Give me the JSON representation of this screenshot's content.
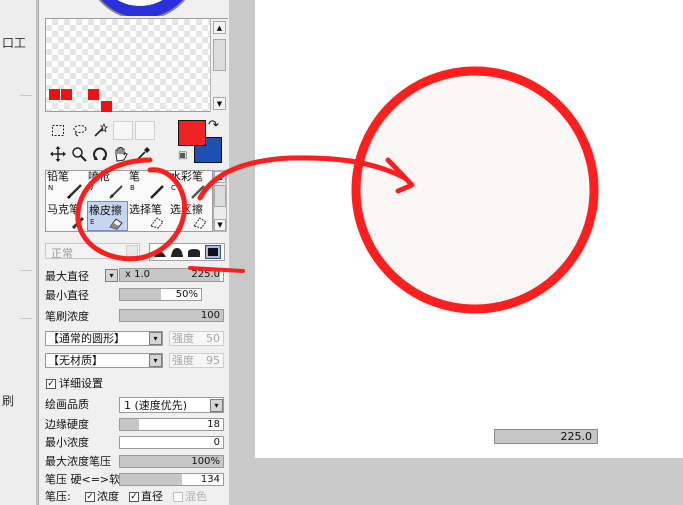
{
  "left_strip": {
    "glyph_top": "口工",
    "glyph_bottom": "刷"
  },
  "texture_grid": {
    "scroll_up": "▲",
    "scroll_down": "▼"
  },
  "selection_tools": {
    "tool_icons": [
      "rect-select-icon",
      "lasso-icon",
      "magic-wand-icon",
      "move-icon",
      "zoom-icon",
      "rotate-icon",
      "hand-icon",
      "eyedropper-icon"
    ]
  },
  "colors": {
    "primary": "#ee2222",
    "secondary": "#1e4fb4",
    "swap_glyph": "↷",
    "reset_glyph": "▣"
  },
  "tools": [
    {
      "name": "铅笔",
      "key": "N"
    },
    {
      "name": "喷枪",
      "key": "V"
    },
    {
      "name": "笔",
      "key": "B"
    },
    {
      "name": "水彩笔",
      "key": "C"
    },
    {
      "name": "马克笔",
      "key": ""
    },
    {
      "name": "橡皮擦",
      "key": "E"
    },
    {
      "name": "选择笔",
      "key": ""
    },
    {
      "name": "选区擦",
      "key": ""
    }
  ],
  "tool_scroll": {
    "up": "▲",
    "down": "▼"
  },
  "blend_mode": {
    "value": "正常"
  },
  "brush_shapes": [
    "soft-round-icon",
    "medium-round-icon",
    "hard-round-icon",
    "square-brush-icon"
  ],
  "max_diameter": {
    "label": "最大直径",
    "multiplier": "x 1.0",
    "value": "225.0",
    "fraction": 0.97
  },
  "min_diameter": {
    "label": "最小直径",
    "value": "50%",
    "fraction": 0.5
  },
  "brush_density": {
    "label": "笔刷浓度",
    "value": "100",
    "fraction": 1.0
  },
  "shape_select": {
    "value": "【通常的圆形】",
    "strength_label": "强度",
    "strength_value": "50"
  },
  "texture_select": {
    "value": "【无材质】",
    "strength_label": "强度",
    "strength_value": "95"
  },
  "detail_settings": {
    "label": "详细设置",
    "checked": "✓"
  },
  "quality": {
    "label": "绘画品质",
    "value": "1 (速度优先)"
  },
  "edge_hardness": {
    "label": "边缘硬度",
    "value": "18",
    "fraction": 0.18
  },
  "min_density": {
    "label": "最小浓度",
    "value": "0",
    "fraction": 0.0
  },
  "max_density_pressure": {
    "label": "最大浓度笔压",
    "value": "100%",
    "fraction": 1.0
  },
  "pressure_hardness": {
    "label": "笔压 硬<=>软",
    "value": "134",
    "fraction": 0.6
  },
  "pressure_opts": {
    "label": "笔压:",
    "density": "浓度",
    "diameter": "直径",
    "blend": "混色",
    "check": "✓"
  },
  "canvas": {
    "size_readout": "225.0"
  },
  "annotation_color": "#ff1f1f"
}
